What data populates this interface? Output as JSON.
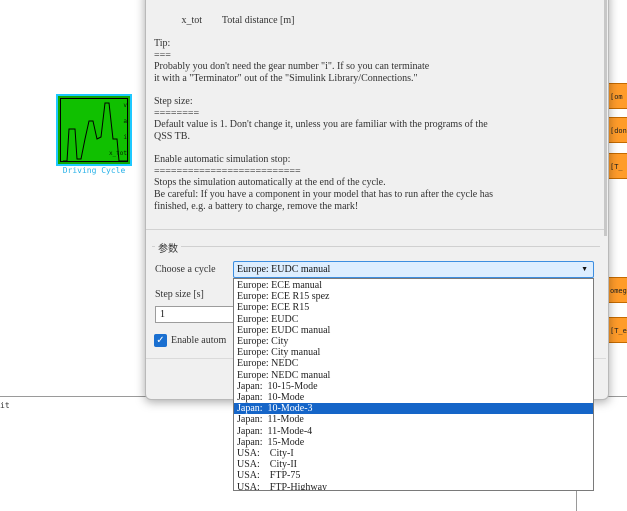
{
  "canvas": {
    "driving_cycle_block": {
      "caption": "Driving Cycle",
      "ports": [
        "v",
        "a",
        "i",
        "x_tot"
      ]
    },
    "goto_tags": [
      "[om",
      "[don",
      "[T_",
      "omega",
      "[T_em"
    ],
    "left_stub_text": "it"
  },
  "dialog": {
    "description": [
      "           x_tot        Total distance [m]",
      "",
      "Tip:",
      "===",
      "Probably you don't need the gear number \"i\". If so you can terminate",
      "it with a \"Terminator\" out of the \"Simulink Library/Connections.\"",
      "",
      "Step size:",
      "========",
      "Default value is 1. Don't change it, unless you are familiar with the programs of the",
      "QSS TB.",
      "",
      "Enable automatic simulation stop:",
      "==========================",
      "Stops the simulation automatically at the end of the cycle.",
      "Be careful: If you have a component in your model that has to run after the cycle has",
      "finished, e.g. a battery to charge, remove the mark!"
    ],
    "parameters_group": "参数",
    "choose_cycle_label": "Choose a cycle",
    "selected_cycle": "Europe: EUDC manual",
    "step_size_label": "Step size [s]",
    "step_size_value": "1",
    "enable_stop_label": "Enable autom",
    "enable_stop_checked": true
  },
  "dropdown": {
    "options": [
      "Europe: ECE manual",
      "Europe: ECE R15 spez",
      "Europe: ECE R15",
      "Europe: EUDC",
      "Europe: EUDC manual",
      "Europe: City",
      "Europe: City manual",
      "Europe: NEDC",
      "Europe: NEDC manual",
      "Japan:  10-15-Mode",
      "Japan:  10-Mode",
      "Japan:  10-Mode-3",
      "Japan:  11-Mode",
      "Japan:  11-Mode-4",
      "Japan:  15-Mode",
      "USA:    City-I",
      "USA:    City-II",
      "USA:    FTP-75",
      "USA:    FTP-Highway"
    ],
    "highlighted_index": 11
  },
  "colors": {
    "block_green": "#10c000",
    "goto_orange": "#ff9c2a",
    "selection_blue": "#1565c8"
  }
}
